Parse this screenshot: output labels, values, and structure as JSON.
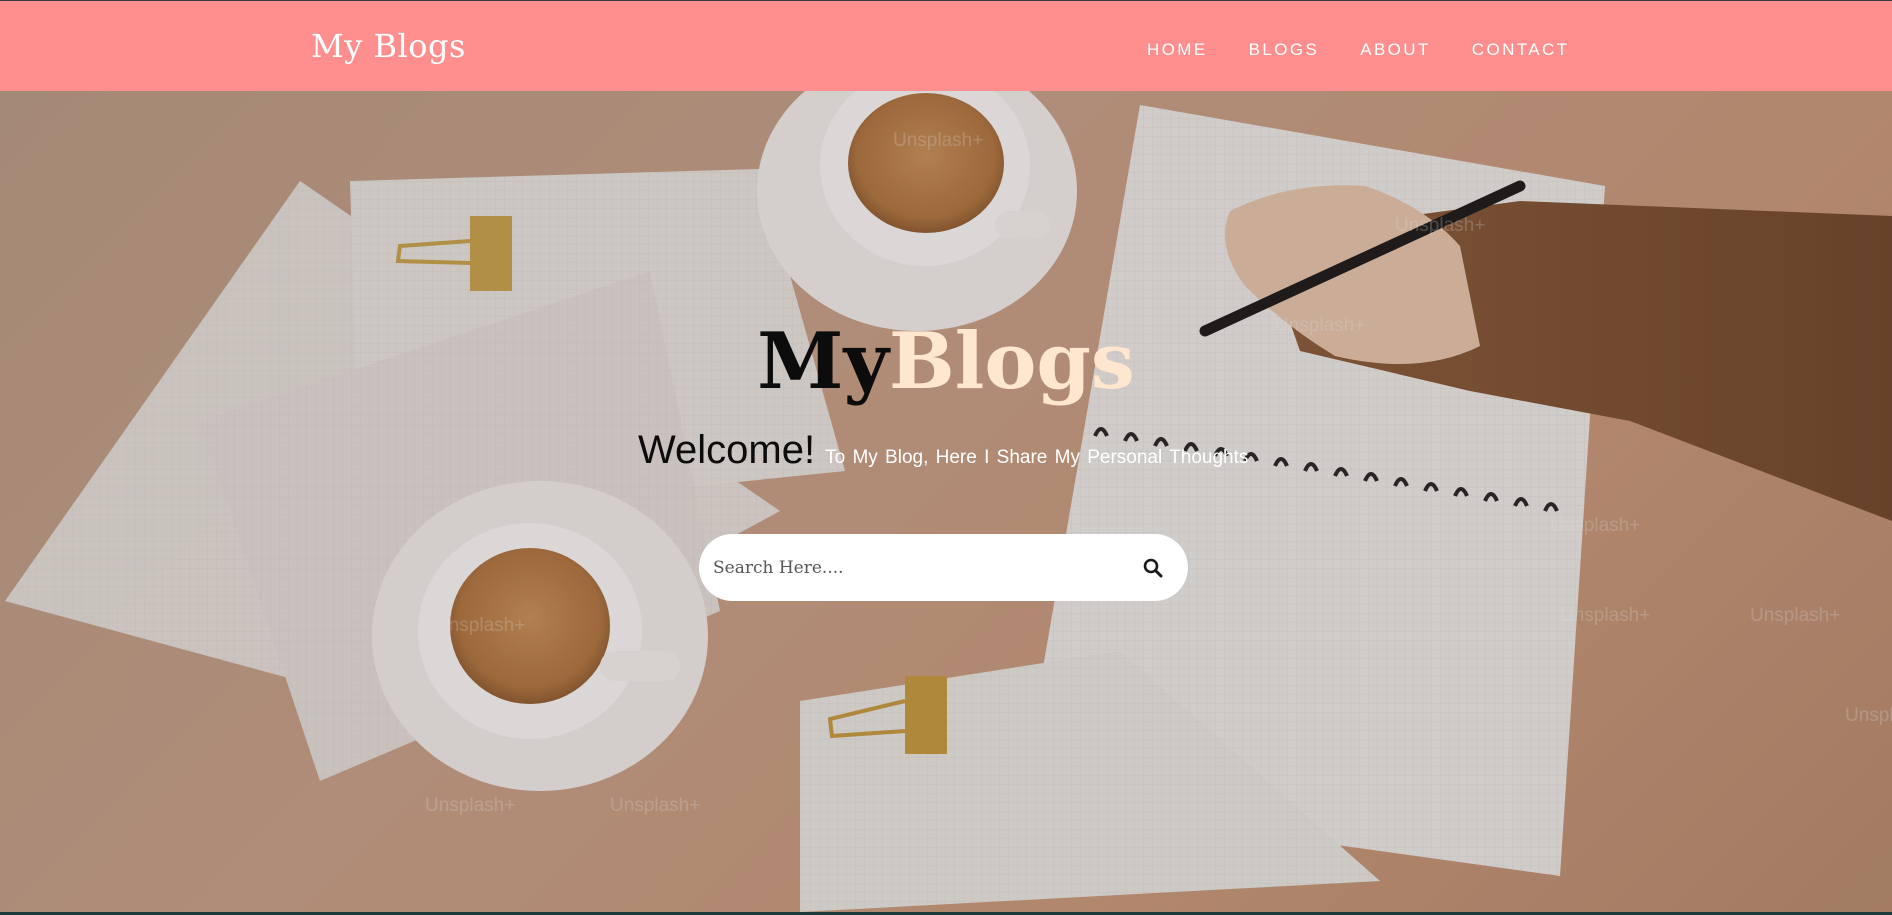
{
  "nav": {
    "brand": "My Blogs",
    "links": [
      "HOME",
      "BLOGS",
      "ABOUT",
      "CONTACT"
    ]
  },
  "hero": {
    "title_part_a": "My",
    "title_part_b": "Blogs",
    "welcome": "Welcome!",
    "tagline": "To My Blog, Here I Share My Personal Thoughts",
    "watermark": "Unsplash+"
  },
  "search": {
    "placeholder": "Search Here....",
    "icon": "search-icon"
  },
  "colors": {
    "navbar": "#ff8f8f",
    "title_accent": "#ffe6cf",
    "footer": "#1d3a3a"
  }
}
